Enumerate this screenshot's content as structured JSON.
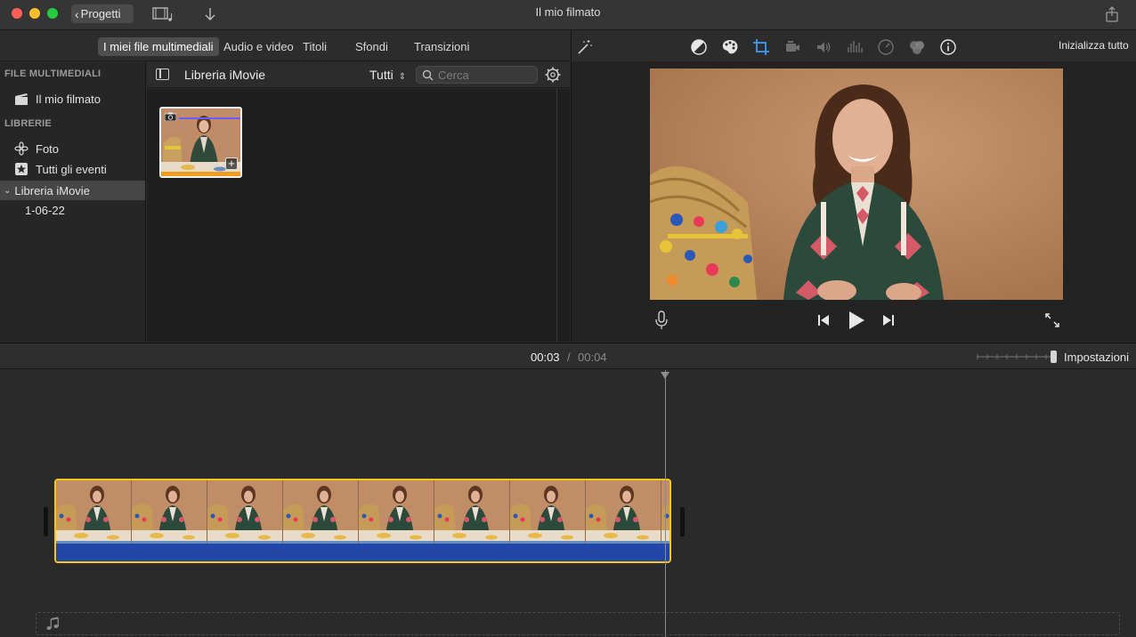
{
  "window": {
    "title": "Il mio filmato",
    "projects_label": "Progetti"
  },
  "tabs": [
    {
      "label": "I miei file multimediali",
      "active": true
    },
    {
      "label": "Audio e video",
      "active": false
    },
    {
      "label": "Titoli",
      "active": false
    },
    {
      "label": "Sfondi",
      "active": false
    },
    {
      "label": "Transizioni",
      "active": false
    }
  ],
  "sidebar": {
    "media_header": "FILE MULTIMEDIALI",
    "project_item": "Il mio filmato",
    "libraries_header": "LIBRERIE",
    "items": [
      {
        "label": "Foto",
        "icon": "photos-icon"
      },
      {
        "label": "Tutti gli eventi",
        "icon": "star-icon"
      }
    ],
    "library": "Libreria iMovie",
    "event": "1-06-22"
  },
  "library_bar": {
    "title": "Libreria iMovie",
    "filter": "Tutti",
    "search_placeholder": "Cerca"
  },
  "viewer": {
    "reset_label": "Inizializza tutto"
  },
  "timecode": {
    "current": "00:03",
    "separator": "/",
    "total": "00:04"
  },
  "timeline": {
    "settings_label": "Impostazioni"
  },
  "colors": {
    "clip_border": "#f5c518",
    "audio_bar": "#2347a8",
    "selection_bar": "#f29b1d"
  }
}
